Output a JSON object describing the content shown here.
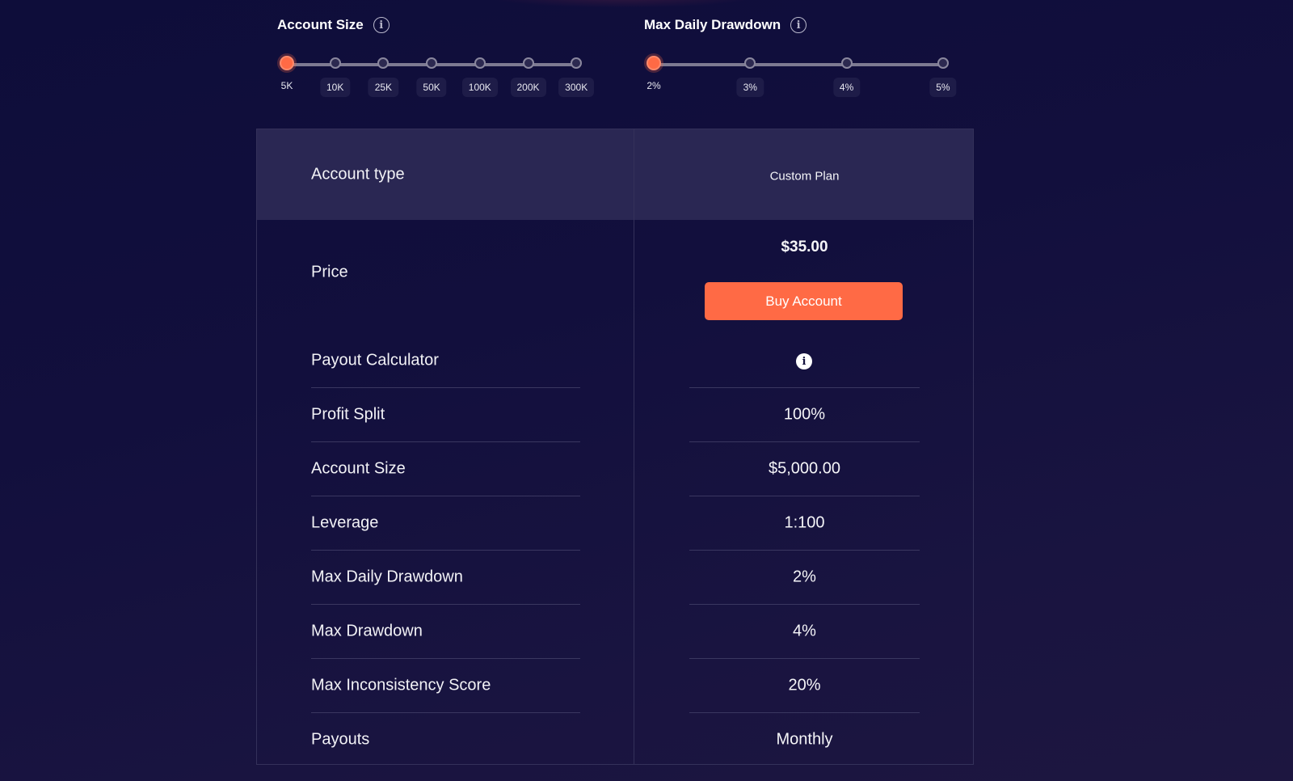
{
  "account_size_slider": {
    "title": "Account Size",
    "info_icon": "info-circle-icon",
    "options": [
      "5K",
      "10K",
      "25K",
      "50K",
      "100K",
      "200K",
      "300K"
    ],
    "selected": "5K"
  },
  "drawdown_slider": {
    "title": "Max Daily Drawdown",
    "info_icon": "info-circle-icon",
    "options": [
      "2%",
      "3%",
      "4%",
      "5%"
    ],
    "selected": "2%"
  },
  "table": {
    "header": {
      "label": "Account type",
      "value": "Custom Plan"
    },
    "price": {
      "label": "Price",
      "value": "$35.00",
      "button_label": "Buy Account"
    },
    "payout_calculator": {
      "label": "Payout Calculator",
      "icon": "info-icon"
    },
    "rows": [
      {
        "label": "Profit Split",
        "value": "100%"
      },
      {
        "label": "Account Size",
        "value": "$5,000.00"
      },
      {
        "label": "Leverage",
        "value": "1:100"
      },
      {
        "label": "Max Daily Drawdown",
        "value": "2%"
      },
      {
        "label": "Max Drawdown",
        "value": "4%"
      },
      {
        "label": "Max Inconsistency Score",
        "value": "20%"
      },
      {
        "label": "Payouts",
        "value": "Monthly"
      }
    ]
  },
  "colors": {
    "accent": "#ff6a45",
    "background": "#120f3d",
    "header_row": "#2a2753",
    "border": "#34315a"
  }
}
